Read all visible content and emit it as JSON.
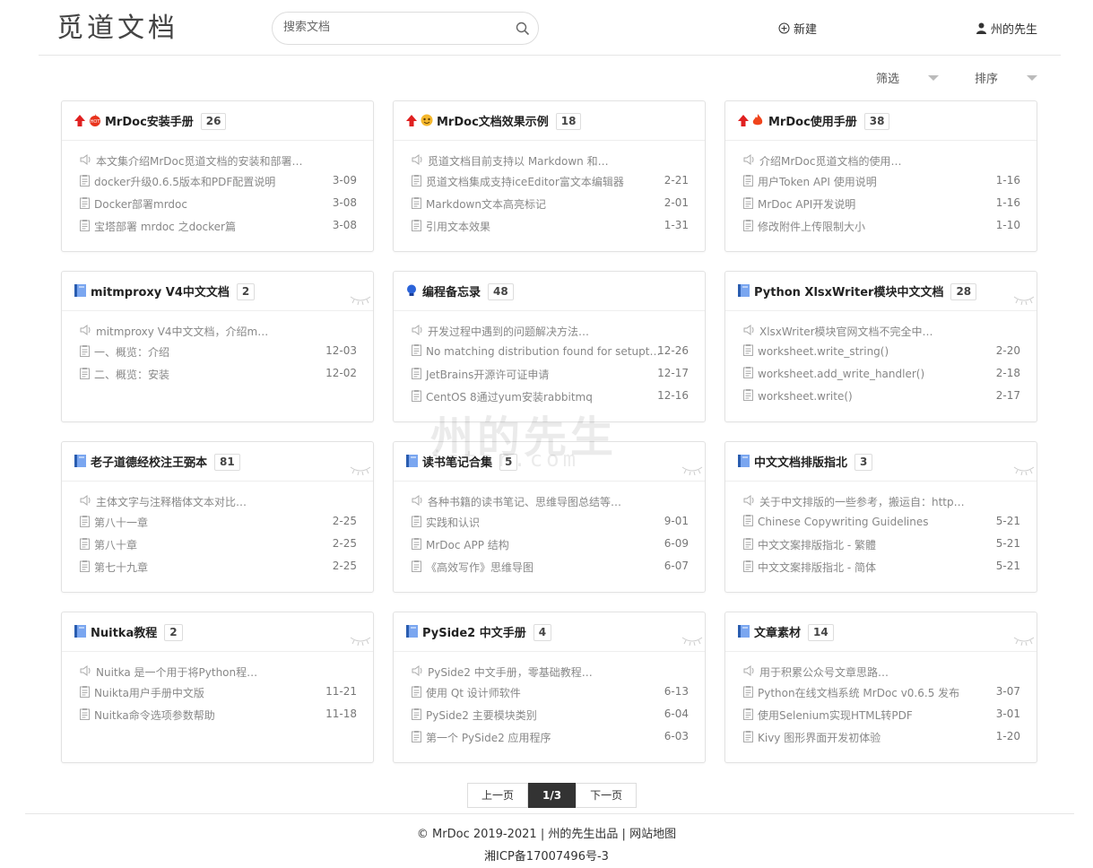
{
  "header": {
    "logo_text": "觅道文档",
    "search_placeholder": "搜索文档",
    "new_label": "新建",
    "user_label": "州的先生"
  },
  "filters": {
    "filter_label": "筛选",
    "sort_label": "排序"
  },
  "cards": [
    {
      "title": "MrDoc安装手册",
      "count": "26",
      "top": true,
      "icon": "hot-icon",
      "desc": "本文集介绍MrDoc觅道文档的安装和部署…",
      "docs": [
        {
          "title": "docker升级0.6.5版本和PDF配置说明",
          "date": "3-09"
        },
        {
          "title": "Docker部署mrdoc",
          "date": "3-08"
        },
        {
          "title": "宝塔部署 mrdoc 之docker篇",
          "date": "3-08"
        }
      ]
    },
    {
      "title": "MrDoc文档效果示例",
      "count": "18",
      "top": true,
      "icon": "emoji-icon",
      "desc": "觅道文档目前支持以 Markdown 和…",
      "docs": [
        {
          "title": "觅道文档集成支持iceEditor富文本编辑器",
          "date": "2-21"
        },
        {
          "title": "Markdown文本高亮标记",
          "date": "2-01"
        },
        {
          "title": "引用文本效果",
          "date": "1-31"
        }
      ]
    },
    {
      "title": "MrDoc使用手册",
      "count": "38",
      "top": true,
      "icon": "fire-icon",
      "desc": "介绍MrDoc觅道文档的使用…",
      "docs": [
        {
          "title": "用户Token API 使用说明",
          "date": "1-16"
        },
        {
          "title": "MrDoc API开发说明",
          "date": "1-16"
        },
        {
          "title": "修改附件上传限制大小",
          "date": "1-10"
        }
      ]
    },
    {
      "title": "mitmproxy V4中文文档",
      "count": "2",
      "top": false,
      "icon": "book-icon",
      "desc": "mitmproxy V4中文文档，介绍m…",
      "docs": [
        {
          "title": "一、概览：介绍",
          "date": "12-03"
        },
        {
          "title": "二、概览：安装",
          "date": "12-02"
        }
      ]
    },
    {
      "title": "编程备忘录",
      "count": "48",
      "top": false,
      "icon": "bulb-icon",
      "desc": "开发过程中遇到的问题解决方法…",
      "docs": [
        {
          "title": "No matching distribution found for setupt…",
          "date": "12-26"
        },
        {
          "title": "JetBrains开源许可证申请",
          "date": "12-17"
        },
        {
          "title": "CentOS 8通过yum安装rabbitmq",
          "date": "12-16"
        }
      ]
    },
    {
      "title": "Python XlsxWriter模块中文文档",
      "count": "28",
      "top": false,
      "icon": "book-icon",
      "desc": "XlsxWriter模块官网文档不完全中…",
      "docs": [
        {
          "title": "worksheet.write_string()",
          "date": "2-20"
        },
        {
          "title": "worksheet.add_write_handler()",
          "date": "2-18"
        },
        {
          "title": "worksheet.write()",
          "date": "2-17"
        }
      ]
    },
    {
      "title": "老子道德经校注王弼本",
      "count": "81",
      "top": false,
      "icon": "book-icon",
      "desc": "主体文字与注释楷体文本对比…",
      "docs": [
        {
          "title": "第八十一章",
          "date": "2-25"
        },
        {
          "title": "第八十章",
          "date": "2-25"
        },
        {
          "title": "第七十九章",
          "date": "2-25"
        }
      ]
    },
    {
      "title": "读书笔记合集",
      "count": "5",
      "top": false,
      "icon": "book-icon",
      "desc": "各种书籍的读书笔记、思维导图总结等…",
      "docs": [
        {
          "title": "实践和认识",
          "date": "9-01"
        },
        {
          "title": "MrDoc APP 结构",
          "date": "6-09"
        },
        {
          "title": "《高效写作》思维导图",
          "date": "6-07"
        }
      ]
    },
    {
      "title": "中文文档排版指北",
      "count": "3",
      "top": false,
      "icon": "book-icon",
      "desc": "关于中文排版的一些参考，搬运自：http…",
      "docs": [
        {
          "title": "Chinese Copywriting Guidelines",
          "date": "5-21"
        },
        {
          "title": "中文文案排版指北 - 繁體",
          "date": "5-21"
        },
        {
          "title": "中文文案排版指北 - 简体",
          "date": "5-21"
        }
      ]
    },
    {
      "title": "Nuitka教程",
      "count": "2",
      "top": false,
      "icon": "book-icon",
      "desc": "Nuitka 是一个用于将Python程…",
      "docs": [
        {
          "title": "Nuikta用户手册中文版",
          "date": "11-21"
        },
        {
          "title": "Nuitka命令选项参数帮助",
          "date": "11-18"
        }
      ]
    },
    {
      "title": "PySide2 中文手册",
      "count": "4",
      "top": false,
      "icon": "book-icon",
      "desc": "PySide2 中文手册，零基础教程…",
      "docs": [
        {
          "title": "使用 Qt 设计师软件",
          "date": "6-13"
        },
        {
          "title": "PySide2 主要模块类别",
          "date": "6-04"
        },
        {
          "title": "第一个 PySide2 应用程序",
          "date": "6-03"
        }
      ]
    },
    {
      "title": "文章素材",
      "count": "14",
      "top": false,
      "icon": "book-icon",
      "desc": "用于积累公众号文章思路…",
      "docs": [
        {
          "title": "Python在线文档系统 MrDoc v0.6.5 发布",
          "date": "3-07"
        },
        {
          "title": "使用Selenium实现HTML转PDF",
          "date": "3-01"
        },
        {
          "title": "Kivy 图形界面开发初体验",
          "date": "1-20"
        }
      ]
    }
  ],
  "watermark": {
    "text": "州的先生",
    "sub": "ister.com"
  },
  "pagination": {
    "prev": "上一页",
    "current": "1/3",
    "next": "下一页"
  },
  "footer": {
    "copyright": "© MrDoc 2019-2021",
    "sep": "|",
    "author": "州的先生出品",
    "sitemap": "网站地图",
    "icp": "湘ICP备17007496号-3"
  },
  "colors": {
    "accent": "#e02020",
    "book": "#3b7ddd",
    "text": "#333333",
    "muted": "#888888"
  }
}
